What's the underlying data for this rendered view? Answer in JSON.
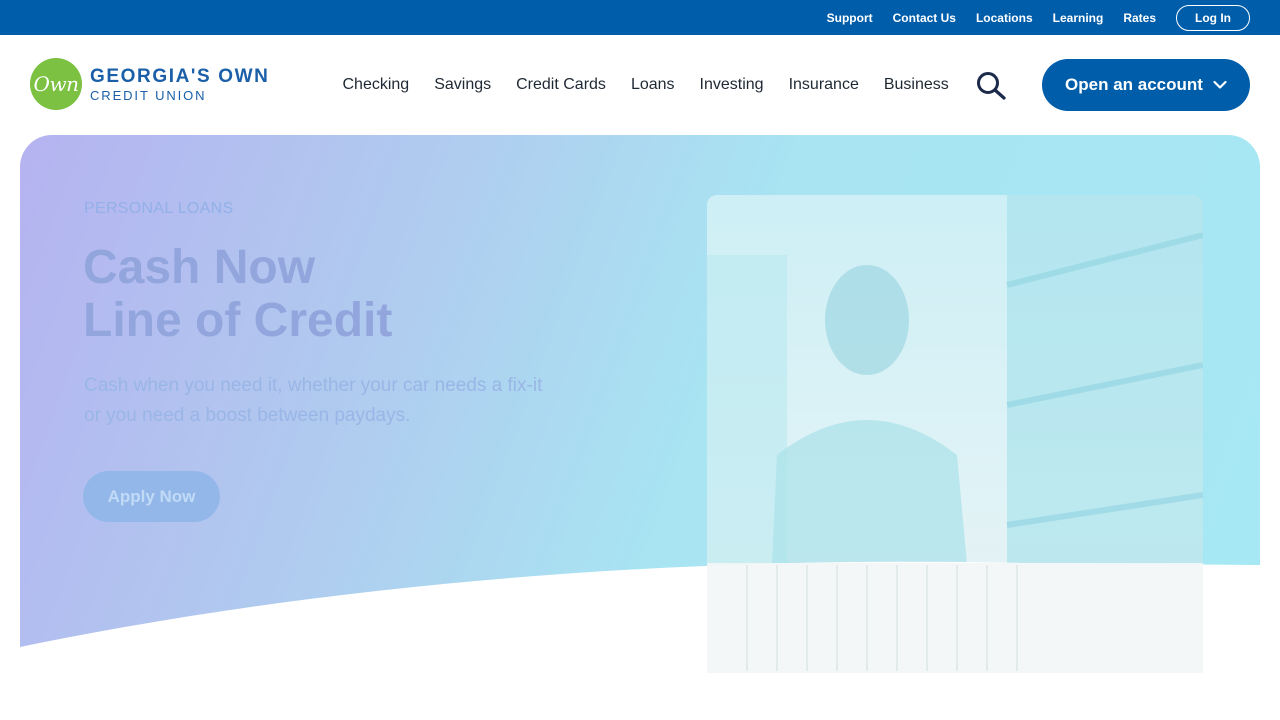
{
  "utility_nav": {
    "links": [
      "Support",
      "Contact Us",
      "Locations",
      "Learning",
      "Rates"
    ],
    "login_label": "Log In"
  },
  "brand": {
    "logo_mark": "Own",
    "name_line1": "GEORGIA'S OWN",
    "name_line2": "CREDIT UNION",
    "logo_color": "#7cc142",
    "brand_color": "#005daa"
  },
  "primary_nav": {
    "items": [
      "Checking",
      "Savings",
      "Credit Cards",
      "Loans",
      "Investing",
      "Insurance",
      "Business"
    ],
    "search_icon": "search-icon",
    "open_account_label": "Open an account",
    "open_account_icon": "chevron-down-icon"
  },
  "hero": {
    "eyebrow": "PERSONAL LOANS",
    "title_line1": "Cash Now",
    "title_line2": "Line of Credit",
    "description": "Cash when you need it, whether your car needs a fix-it or you need a boost between paydays.",
    "cta_label": "Apply Now",
    "gradient_start": "#b5b3f0",
    "gradient_end": "#a6e8f3"
  }
}
